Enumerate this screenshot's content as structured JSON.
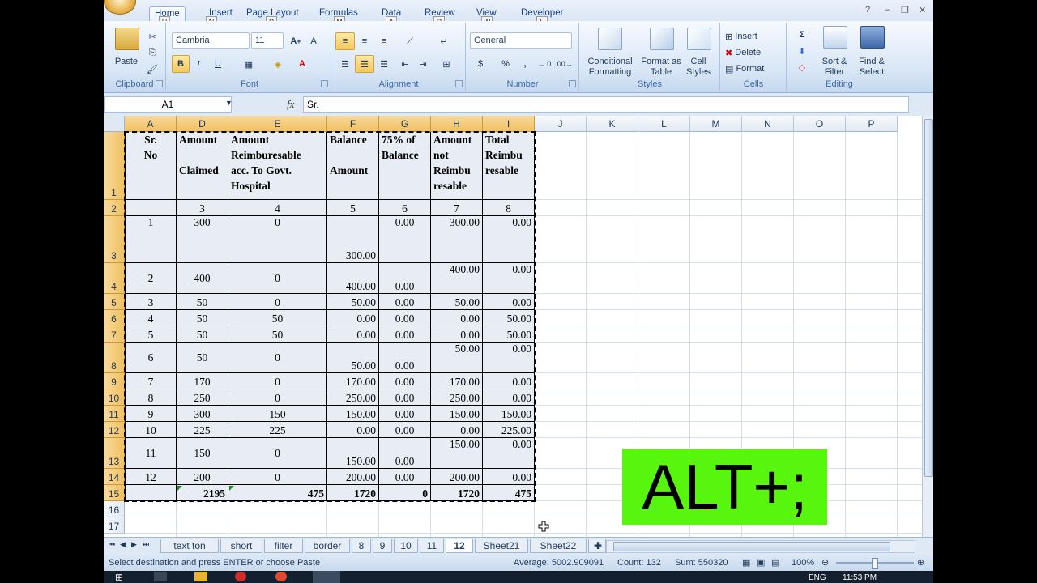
{
  "ribbon_tabs": [
    {
      "label": "Home",
      "keytip": "H"
    },
    {
      "label": "Insert",
      "keytip": "N"
    },
    {
      "label": "Page Layout",
      "keytip": "P"
    },
    {
      "label": "Formulas",
      "keytip": "M"
    },
    {
      "label": "Data",
      "keytip": "A"
    },
    {
      "label": "Review",
      "keytip": "R"
    },
    {
      "label": "View",
      "keytip": "W"
    },
    {
      "label": "Developer",
      "keytip": "L"
    }
  ],
  "ribbon": {
    "clipboard": {
      "paste": "Paste",
      "label": "Clipboard"
    },
    "font": {
      "name": "Cambria",
      "size": "11",
      "label": "Font",
      "bold": "B",
      "italic": "I",
      "underline": "U"
    },
    "alignment": {
      "label": "Alignment"
    },
    "number": {
      "format": "General",
      "label": "Number",
      "currency": "$",
      "percent": "%",
      "comma": ","
    },
    "styles": {
      "conditional": "Conditional Formatting",
      "format_table": "Format as Table",
      "cell_styles": "Cell Styles",
      "label": "Styles"
    },
    "cells": {
      "insert": "Insert",
      "delete": "Delete",
      "format": "Format",
      "label": "Cells"
    },
    "editing": {
      "sort": "Sort & Filter",
      "find": "Find & Select",
      "label": "Editing"
    }
  },
  "formula_bar": {
    "name_box": "A1",
    "fx": "fx",
    "value": "Sr."
  },
  "columns": [
    "A",
    "D",
    "E",
    "F",
    "G",
    "H",
    "I",
    "J",
    "K",
    "L",
    "M",
    "N",
    "O",
    "P"
  ],
  "rows": [
    "1",
    "2",
    "3",
    "4",
    "5",
    "6",
    "7",
    "8",
    "9",
    "10",
    "11",
    "12",
    "13",
    "14",
    "15",
    "16",
    "17"
  ],
  "table": {
    "headers": [
      [
        "Sr.",
        "No"
      ],
      [
        "Amount",
        "",
        "Claimed"
      ],
      [
        "Amount",
        "Reimburesable",
        "acc. To Govt.",
        "Hospital"
      ],
      [
        "Balance",
        "",
        "Amount"
      ],
      [
        "75% of",
        "Balance"
      ],
      [
        "Amount",
        " not",
        "Reimbu",
        "resable"
      ],
      [
        "Total",
        "Reimbu",
        "resable"
      ]
    ],
    "col_numbers": [
      "",
      "3",
      "4",
      "5",
      "6",
      "7",
      "8"
    ],
    "data": [
      [
        "1",
        "300",
        "0",
        "300.00",
        "0.00",
        "300.00",
        "0.00"
      ],
      [
        "2",
        "400",
        "0",
        "400.00",
        "0.00",
        "400.00",
        "0.00"
      ],
      [
        "3",
        "50",
        "0",
        "50.00",
        "0.00",
        "50.00",
        "0.00"
      ],
      [
        "4",
        "50",
        "50",
        "0.00",
        "0.00",
        "0.00",
        "50.00"
      ],
      [
        "5",
        "50",
        "50",
        "0.00",
        "0.00",
        "0.00",
        "50.00"
      ],
      [
        "6",
        "50",
        "0",
        "50.00",
        "0.00",
        "50.00",
        "0.00"
      ],
      [
        "7",
        "170",
        "0",
        "170.00",
        "0.00",
        "170.00",
        "0.00"
      ],
      [
        "8",
        "250",
        "0",
        "250.00",
        "0.00",
        "250.00",
        "0.00"
      ],
      [
        "9",
        "300",
        "150",
        "150.00",
        "0.00",
        "150.00",
        "150.00"
      ],
      [
        "10",
        "225",
        "225",
        "0.00",
        "0.00",
        "0.00",
        "225.00"
      ],
      [
        "11",
        "150",
        "0",
        "150.00",
        "0.00",
        "150.00",
        "0.00"
      ],
      [
        "12",
        "200",
        "0",
        "200.00",
        "0.00",
        "200.00",
        "0.00"
      ]
    ],
    "totals": [
      "",
      "2195",
      "475",
      "1720",
      "0",
      "1720",
      "475"
    ]
  },
  "overlay_text": "ALT+;",
  "sheets": [
    "text ton",
    "short",
    "filter",
    "border",
    "8",
    "9",
    "10",
    "11",
    "12",
    "Sheet21",
    "Sheet22"
  ],
  "active_sheet": "12",
  "status": {
    "message": "Select destination and press ENTER or choose Paste",
    "average": "Average: 5002.909091",
    "count": "Count: 132",
    "sum": "Sum: 550320",
    "zoom": "100%"
  },
  "taskbar": {
    "lang": "ENG",
    "time": "11:53 PM"
  },
  "colors": {
    "overlay_bg": "#58f50e",
    "selected_header": "#f1c15f",
    "ribbon_bg": "#dfe9f5"
  }
}
